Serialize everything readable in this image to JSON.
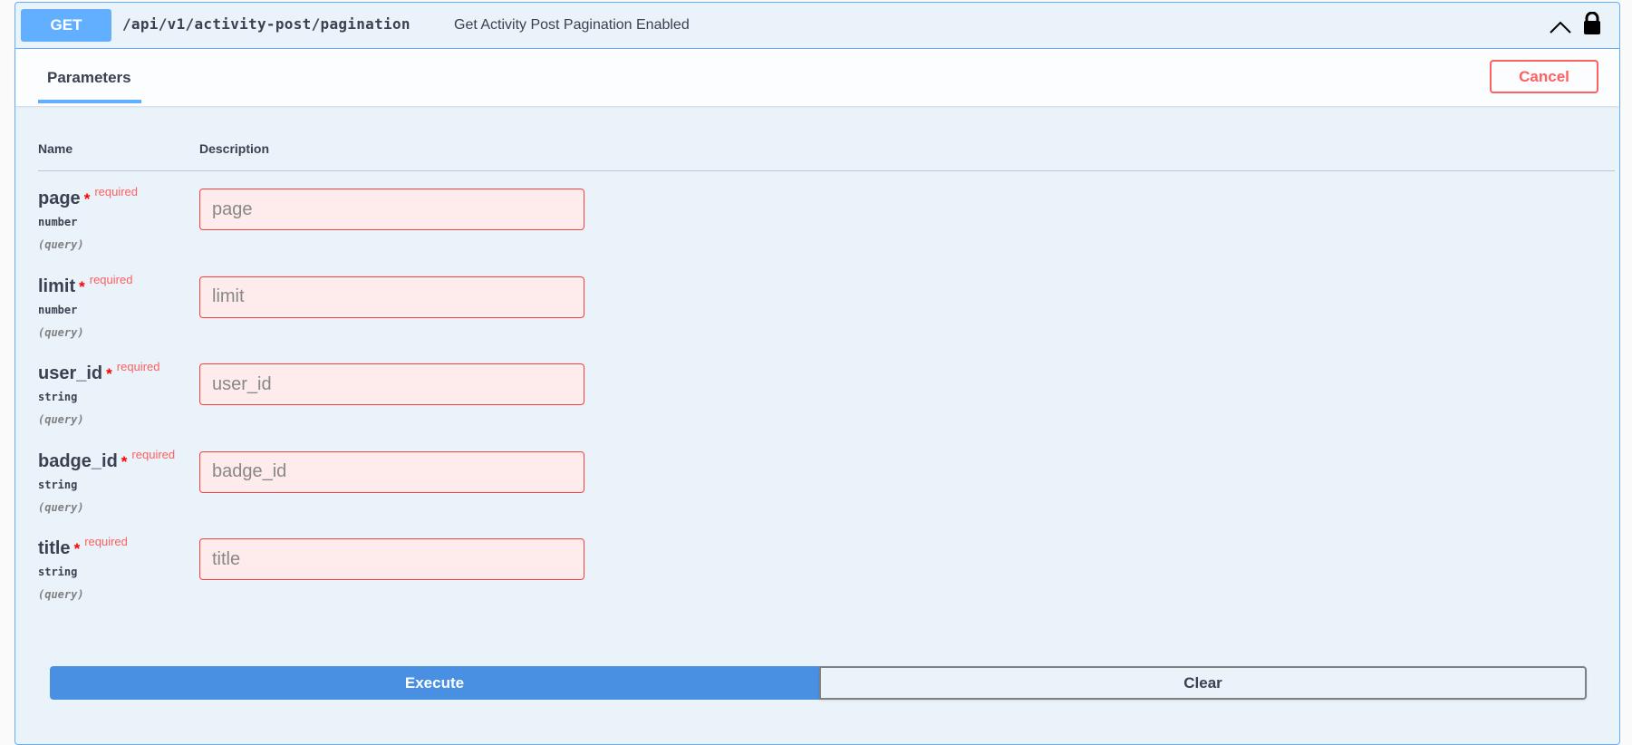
{
  "operation": {
    "method": "GET",
    "path": "/api/v1/activity-post/pagination",
    "summary": "Get Activity Post Pagination Enabled",
    "colors": {
      "method": "#61affe",
      "border": "#61affe"
    }
  },
  "tabs": {
    "parameters_label": "Parameters",
    "cancel_label": "Cancel"
  },
  "table": {
    "name_header": "Name",
    "description_header": "Description"
  },
  "parameters": [
    {
      "name": "page",
      "required_mark": "*",
      "required_label": "required",
      "type": "number",
      "in": "(query)",
      "placeholder": "page",
      "value": ""
    },
    {
      "name": "limit",
      "required_mark": "*",
      "required_label": "required",
      "type": "number",
      "in": "(query)",
      "placeholder": "limit",
      "value": ""
    },
    {
      "name": "user_id",
      "required_mark": "*",
      "required_label": "required",
      "type": "string",
      "in": "(query)",
      "placeholder": "user_id",
      "value": ""
    },
    {
      "name": "badge_id",
      "required_mark": "*",
      "required_label": "required",
      "type": "string",
      "in": "(query)",
      "placeholder": "badge_id",
      "value": ""
    },
    {
      "name": "title",
      "required_mark": "*",
      "required_label": "required",
      "type": "string",
      "in": "(query)",
      "placeholder": "title",
      "value": ""
    }
  ],
  "actions": {
    "execute_label": "Execute",
    "clear_label": "Clear"
  },
  "icons": {
    "collapse": "chevron-up-icon",
    "auth": "lock-icon"
  }
}
